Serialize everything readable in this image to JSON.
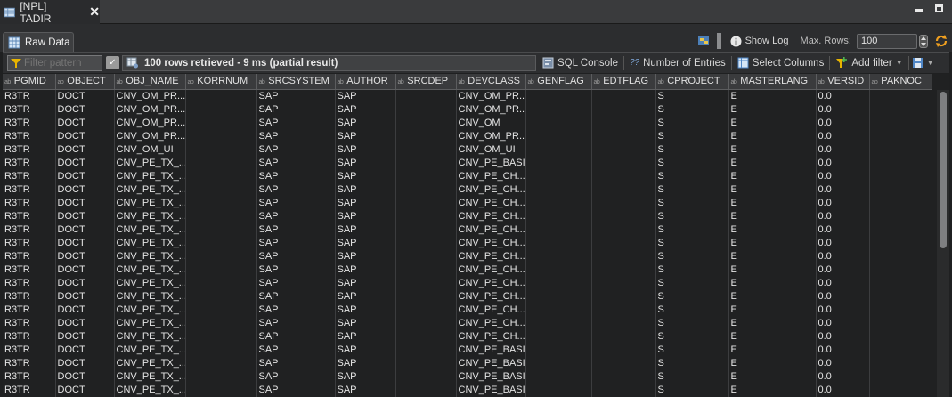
{
  "editor_tab": {
    "label": "[NPL] TADIR",
    "close": "✕"
  },
  "raw_tab": {
    "label": "Raw Data"
  },
  "top_tools": {
    "show_log": "Show Log",
    "max_rows_label": "Max. Rows:",
    "max_rows_value": "100"
  },
  "toolbar": {
    "filter_placeholder": "Filter pattern",
    "status": "100 rows retrieved - 9 ms (partial result)",
    "sql_console": "SQL Console",
    "number_of_entries": "Number of Entries",
    "select_columns": "Select Columns",
    "add_filter": "Add filter"
  },
  "table": {
    "columns": [
      "PGMID",
      "OBJECT",
      "OBJ_NAME",
      "KORRNUM",
      "SRCSYSTEM",
      "AUTHOR",
      "SRCDEP",
      "DEVCLASS",
      "GENFLAG",
      "EDTFLAG",
      "CPROJECT",
      "MASTERLANG",
      "VERSID",
      "PAKNOC"
    ],
    "rows": [
      [
        "R3TR",
        "DOCT",
        "CNV_OM_PR...",
        "",
        "SAP",
        "SAP",
        "",
        "CNV_OM_PR...",
        "",
        "",
        "S",
        "E",
        "0.0",
        ""
      ],
      [
        "R3TR",
        "DOCT",
        "CNV_OM_PR...",
        "",
        "SAP",
        "SAP",
        "",
        "CNV_OM_PR...",
        "",
        "",
        "S",
        "E",
        "0.0",
        ""
      ],
      [
        "R3TR",
        "DOCT",
        "CNV_OM_PR...",
        "",
        "SAP",
        "SAP",
        "",
        "CNV_OM",
        "",
        "",
        "S",
        "E",
        "0.0",
        ""
      ],
      [
        "R3TR",
        "DOCT",
        "CNV_OM_PR...",
        "",
        "SAP",
        "SAP",
        "",
        "CNV_OM_PR...",
        "",
        "",
        "S",
        "E",
        "0.0",
        ""
      ],
      [
        "R3TR",
        "DOCT",
        "CNV_OM_UI",
        "",
        "SAP",
        "SAP",
        "",
        "CNV_OM_UI",
        "",
        "",
        "S",
        "E",
        "0.0",
        ""
      ],
      [
        "R3TR",
        "DOCT",
        "CNV_PE_TX_...",
        "",
        "SAP",
        "SAP",
        "",
        "CNV_PE_BASIS",
        "",
        "",
        "S",
        "E",
        "0.0",
        ""
      ],
      [
        "R3TR",
        "DOCT",
        "CNV_PE_TX_...",
        "",
        "SAP",
        "SAP",
        "",
        "CNV_PE_CH...",
        "",
        "",
        "S",
        "E",
        "0.0",
        ""
      ],
      [
        "R3TR",
        "DOCT",
        "CNV_PE_TX_...",
        "",
        "SAP",
        "SAP",
        "",
        "CNV_PE_CH...",
        "",
        "",
        "S",
        "E",
        "0.0",
        ""
      ],
      [
        "R3TR",
        "DOCT",
        "CNV_PE_TX_...",
        "",
        "SAP",
        "SAP",
        "",
        "CNV_PE_CH...",
        "",
        "",
        "S",
        "E",
        "0.0",
        ""
      ],
      [
        "R3TR",
        "DOCT",
        "CNV_PE_TX_...",
        "",
        "SAP",
        "SAP",
        "",
        "CNV_PE_CH...",
        "",
        "",
        "S",
        "E",
        "0.0",
        ""
      ],
      [
        "R3TR",
        "DOCT",
        "CNV_PE_TX_...",
        "",
        "SAP",
        "SAP",
        "",
        "CNV_PE_CH...",
        "",
        "",
        "S",
        "E",
        "0.0",
        ""
      ],
      [
        "R3TR",
        "DOCT",
        "CNV_PE_TX_...",
        "",
        "SAP",
        "SAP",
        "",
        "CNV_PE_CH...",
        "",
        "",
        "S",
        "E",
        "0.0",
        ""
      ],
      [
        "R3TR",
        "DOCT",
        "CNV_PE_TX_...",
        "",
        "SAP",
        "SAP",
        "",
        "CNV_PE_CH...",
        "",
        "",
        "S",
        "E",
        "0.0",
        ""
      ],
      [
        "R3TR",
        "DOCT",
        "CNV_PE_TX_...",
        "",
        "SAP",
        "SAP",
        "",
        "CNV_PE_CH...",
        "",
        "",
        "S",
        "E",
        "0.0",
        ""
      ],
      [
        "R3TR",
        "DOCT",
        "CNV_PE_TX_...",
        "",
        "SAP",
        "SAP",
        "",
        "CNV_PE_CH...",
        "",
        "",
        "S",
        "E",
        "0.0",
        ""
      ],
      [
        "R3TR",
        "DOCT",
        "CNV_PE_TX_...",
        "",
        "SAP",
        "SAP",
        "",
        "CNV_PE_CH...",
        "",
        "",
        "S",
        "E",
        "0.0",
        ""
      ],
      [
        "R3TR",
        "DOCT",
        "CNV_PE_TX_...",
        "",
        "SAP",
        "SAP",
        "",
        "CNV_PE_CH...",
        "",
        "",
        "S",
        "E",
        "0.0",
        ""
      ],
      [
        "R3TR",
        "DOCT",
        "CNV_PE_TX_...",
        "",
        "SAP",
        "SAP",
        "",
        "CNV_PE_CH...",
        "",
        "",
        "S",
        "E",
        "0.0",
        ""
      ],
      [
        "R3TR",
        "DOCT",
        "CNV_PE_TX_...",
        "",
        "SAP",
        "SAP",
        "",
        "CNV_PE_CH...",
        "",
        "",
        "S",
        "E",
        "0.0",
        ""
      ],
      [
        "R3TR",
        "DOCT",
        "CNV_PE_TX_...",
        "",
        "SAP",
        "SAP",
        "",
        "CNV_PE_BASIS",
        "",
        "",
        "S",
        "E",
        "0.0",
        ""
      ],
      [
        "R3TR",
        "DOCT",
        "CNV_PE_TX_...",
        "",
        "SAP",
        "SAP",
        "",
        "CNV_PE_BASIS",
        "",
        "",
        "S",
        "E",
        "0.0",
        ""
      ],
      [
        "R3TR",
        "DOCT",
        "CNV_PE_TX_...",
        "",
        "SAP",
        "SAP",
        "",
        "CNV_PE_BASIS",
        "",
        "",
        "S",
        "E",
        "0.0",
        ""
      ],
      [
        "R3TR",
        "DOCT",
        "CNV_PE_TX_...",
        "",
        "SAP",
        "SAP",
        "",
        "CNV_PE_BASIS",
        "",
        "",
        "S",
        "E",
        "0.0",
        ""
      ]
    ]
  },
  "icons": [
    "table-icon",
    "close-icon",
    "minimize-icon",
    "maximize-icon",
    "grid-chart-icon",
    "info-icon",
    "refresh-icon",
    "funnel-icon",
    "clear-filter-icon",
    "table-status-icon",
    "sql-console-icon",
    "count-icon",
    "columns-icon",
    "add-filter-icon",
    "save-icon",
    "chevron-down-icon",
    "scroll-thumb"
  ],
  "colors": {
    "accent": "#7fb0e0",
    "filter_yellow": "#e8b400"
  }
}
